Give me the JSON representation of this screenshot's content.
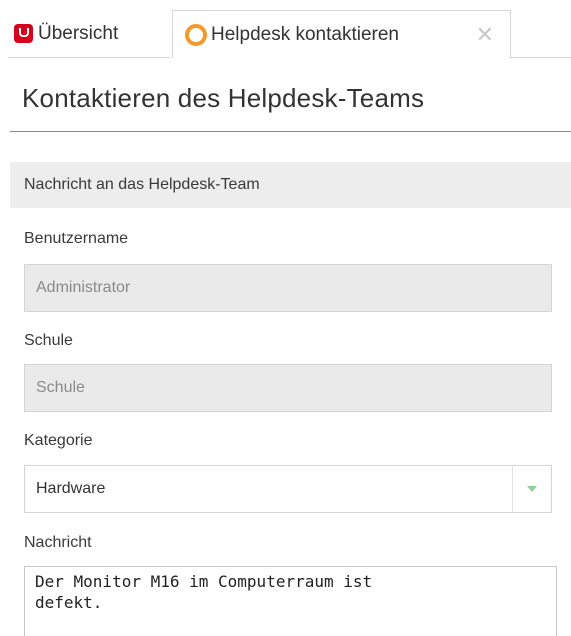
{
  "tabs": [
    {
      "label": "Übersicht",
      "icon": "ucs-logo-icon"
    },
    {
      "label": "Helpdesk kontaktieren",
      "icon": "lifebuoy-icon",
      "close": "✕"
    }
  ],
  "page": {
    "title": "Kontaktieren des Helpdesk-Teams"
  },
  "section": {
    "title": "Nachricht an das Helpdesk-Team"
  },
  "form": {
    "username_label": "Benutzername",
    "username_value": "Administrator",
    "school_label": "Schule",
    "school_value": "Schule",
    "category_label": "Kategorie",
    "category_value": "Hardware",
    "message_label": "Nachricht",
    "message_value": "Der Monitor M16 im Computerraum ist\ndefekt."
  },
  "colors": {
    "accent_red": "#d6001c",
    "lifebuoy_orange": "#f39a2c",
    "dropdown_arrow": "#8fcf8f"
  }
}
